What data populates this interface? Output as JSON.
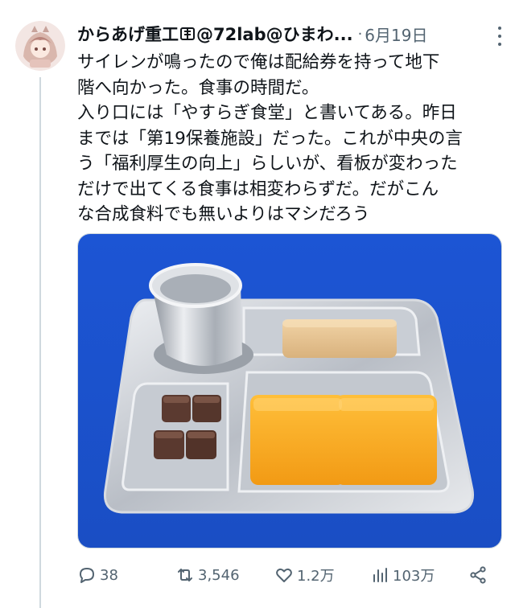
{
  "tweet": {
    "display_name": "からあげ重工",
    "display_name_suffix": "@72lab@ひまわ...",
    "separator": "·",
    "date": "6月19日",
    "text_lines": [
      "サイレンが鳴ったので俺は配給券を持って地下",
      "階へ向かった。食事の時間だ。",
      "入り口には「やすらぎ食堂」と書いてある。昨日",
      "までは「第19保養施設」だった。これが中央の言",
      "う「福利厚生の向上」らしいが、看板が変わった",
      "だけで出てくる食事は相変わらずだ。だがこん",
      "な合成食料でも無いよりはマシだろう"
    ]
  },
  "actions": {
    "reply_count": "38",
    "retweet_count": "3,546",
    "like_count": "1.2万",
    "view_count": "103万"
  },
  "icons": {
    "avatar": "avatar-anime-girl",
    "more": "more-dots-icon",
    "reply": "reply-icon",
    "retweet": "retweet-icon",
    "like": "heart-icon",
    "views": "views-icon",
    "share": "share-icon"
  },
  "colors": {
    "secondary_text": "#536471",
    "media_background": "#1e5ad6",
    "thread_line": "#cfd9de"
  }
}
